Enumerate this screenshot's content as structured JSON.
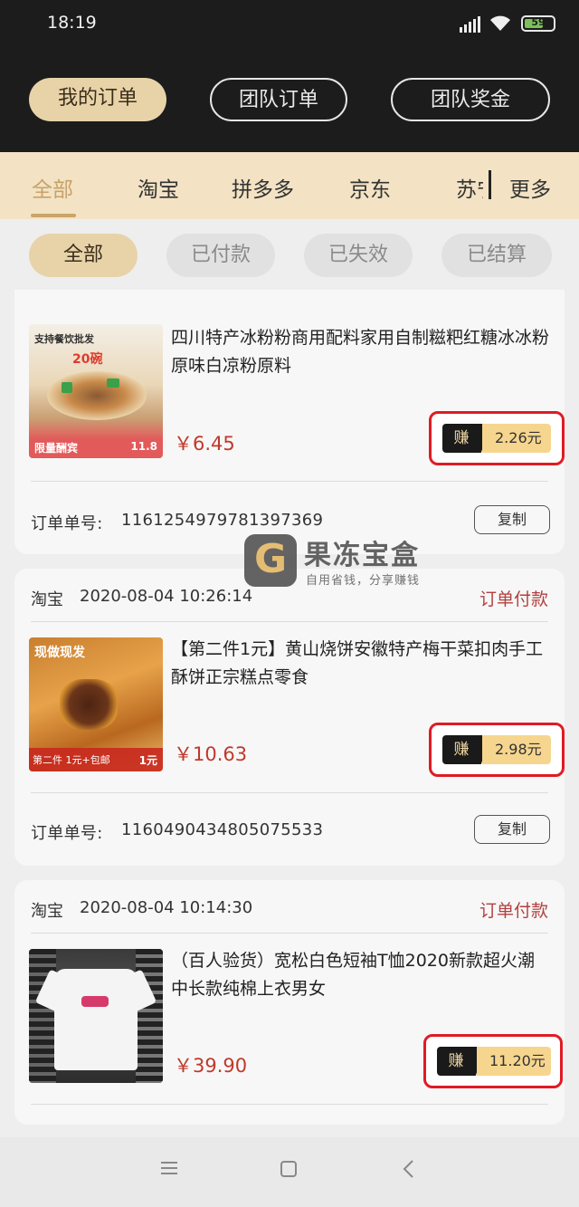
{
  "status_bar": {
    "time": "18:19",
    "battery": "59"
  },
  "main_tabs": [
    {
      "label": "我的订单",
      "active": true
    },
    {
      "label": "团队订单",
      "active": false
    },
    {
      "label": "团队奖金",
      "active": false
    }
  ],
  "platform_tabs": [
    "全部",
    "淘宝",
    "拼多多",
    "京东",
    "苏宁"
  ],
  "platform_more": "更多",
  "status_filters": [
    "全部",
    "已付款",
    "已失效",
    "已结算"
  ],
  "earn_label": "赚",
  "copy_label": "复制",
  "order_no_label": "订单单号:",
  "orders": [
    {
      "title": "四川特产冰粉粉商用配料家用自制糍粑红糖冰冰粉原味白凉粉原料",
      "price": "￥6.45",
      "earn": "2.26元",
      "order_no": "1161254979781397369",
      "thumb_text": {
        "top": "支持餐饮批发",
        "mid": "20碗",
        "bottom_left": "限量酬宾",
        "bottom_right": "11.8"
      }
    },
    {
      "shop": "淘宝",
      "date": "2020-08-04 10:26:14",
      "status": "订单付款",
      "title": "【第二件1元】黄山烧饼安徽特产梅干菜扣肉手工酥饼正宗糕点零食",
      "price": "￥10.63",
      "earn": "2.98元",
      "order_no": "1160490434805075533",
      "thumb_text": {
        "top": "现做现发",
        "bottom_left": "第二件 1元+包邮",
        "bottom_right": "1元"
      }
    },
    {
      "shop": "淘宝",
      "date": "2020-08-04 10:14:30",
      "status": "订单付款",
      "title": "（百人验货）宽松白色短袖T恤2020新款超火潮中长款纯棉上衣男女",
      "price": "￥39.90",
      "earn": "11.20元"
    }
  ],
  "watermark": {
    "title": "果冻宝盒",
    "subtitle": "自用省钱，分享赚钱"
  },
  "colors": {
    "header_bg": "#1c1c1c",
    "accent_gold": "#e8d3a9",
    "tab_bar_bg": "#f3e3c4",
    "price_red": "#c0392b",
    "highlight_red": "#e01b24"
  }
}
